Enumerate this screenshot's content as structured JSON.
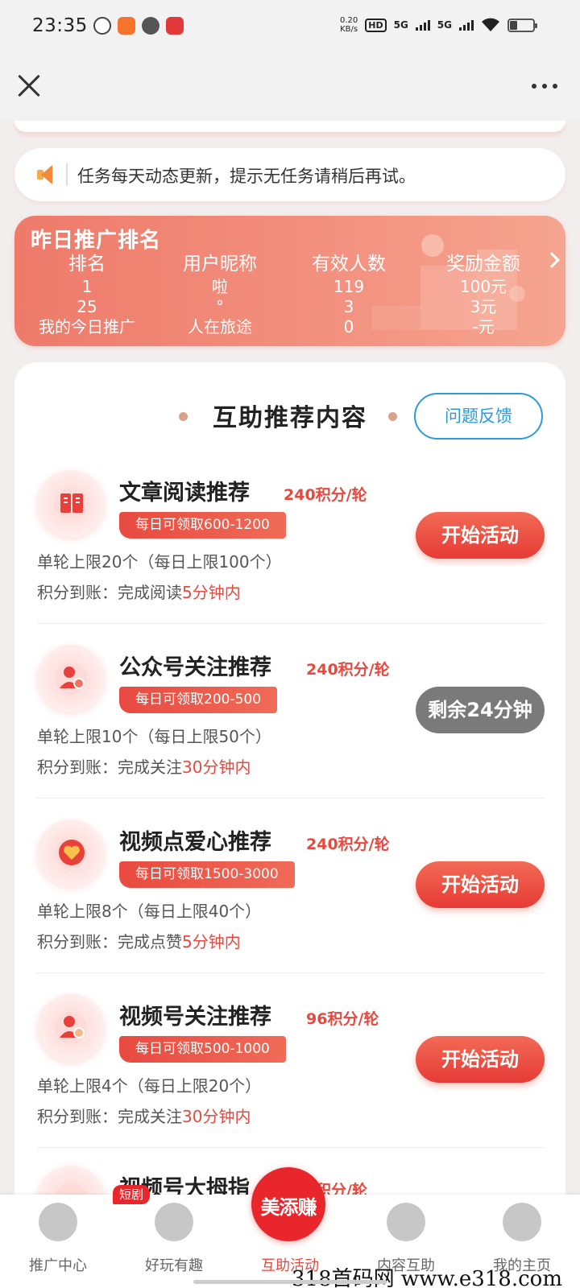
{
  "status_bar": {
    "time": "23:35",
    "net_speed_value": "0.20",
    "net_speed_unit": "KB/s",
    "hd_label": "HD",
    "signal_1": "5G",
    "signal_2": "5G"
  },
  "notice": {
    "text": "任务每天动态更新，提示无任务请稍后再试。"
  },
  "ranking": {
    "title": "昨日推广排名",
    "headers": [
      "排名",
      "用户昵称",
      "有效人数",
      "奖励金额"
    ],
    "rows": [
      [
        "1",
        "啦",
        "119",
        "100元"
      ],
      [
        "25",
        "°",
        "3",
        "3元"
      ],
      [
        "我的今日推广",
        "人在旅途",
        "0",
        "-元"
      ]
    ]
  },
  "section": {
    "title": "互助推荐内容",
    "feedback_label": "问题反馈"
  },
  "tasks": [
    {
      "name": "文章阅读推荐",
      "points": "240积分/轮",
      "badge": "每日可领取600-1200",
      "limit": "单轮上限20个（每日上限100个）",
      "arrival_prefix": "积分到账：完成阅读",
      "arrival_time": "5分钟内",
      "button": "开始活动",
      "icon": "book-icon"
    },
    {
      "name": "公众号关注推荐",
      "points": "240积分/轮",
      "badge": "每日可领取200-500",
      "limit": "单轮上限10个（每日上限50个）",
      "arrival_prefix": "积分到账：完成关注",
      "arrival_time": "30分钟内",
      "button": "剩余24分钟",
      "icon": "user-star-icon"
    },
    {
      "name": "视频点爱心推荐",
      "points": "240积分/轮",
      "badge": "每日可领取1500-3000",
      "limit": "单轮上限8个（每日上限40个）",
      "arrival_prefix": "积分到账：完成点赞",
      "arrival_time": "5分钟内",
      "button": "开始活动",
      "icon": "heart-icon"
    },
    {
      "name": "视频号关注推荐",
      "points": "96积分/轮",
      "badge": "每日可领取500-1000",
      "limit": "单轮上限4个（每日上限20个）",
      "arrival_prefix": "积分到账：完成关注",
      "arrival_time": "30分钟内",
      "button": "开始活动",
      "icon": "user-flower-icon"
    },
    {
      "name": "视频号大拇指",
      "points": "积分/轮"
    }
  ],
  "tabbar": {
    "items": [
      "推广中心",
      "好玩有趣",
      "互助活动",
      "内容互助",
      "我的主页"
    ],
    "short_drama_badge": "短剧",
    "center_logo": "美添赚"
  },
  "watermark": "318首码网 www.e318.com",
  "colors": {
    "accent": "#e5493f",
    "link": "#2b9bd8",
    "disabled": "#7a7a7a"
  }
}
